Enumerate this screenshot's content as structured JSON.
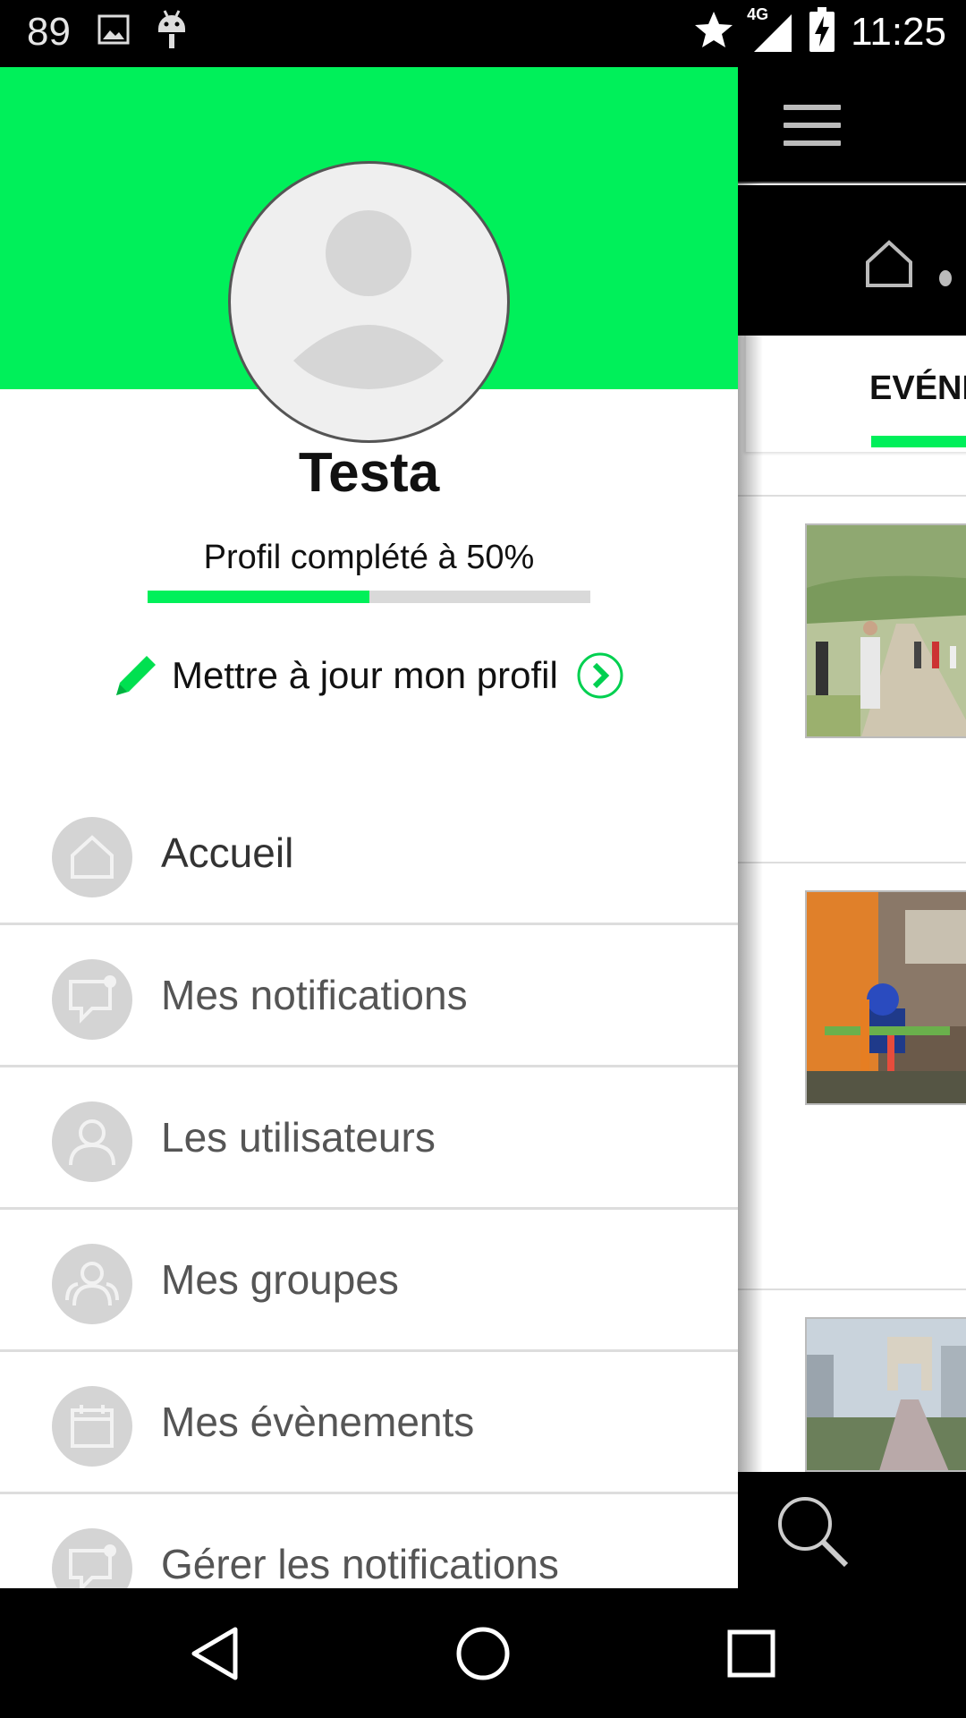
{
  "status_bar": {
    "notification_count": "89",
    "network_label": "4G",
    "time": "11:25",
    "icons": [
      "image-icon",
      "android-icon",
      "star-icon",
      "signal-icon",
      "battery-charging-icon"
    ]
  },
  "background_app": {
    "tab_label": "EVÉNE",
    "icons": [
      "hamburger-icon",
      "home-icon",
      "search-icon"
    ]
  },
  "drawer": {
    "user_name": "Testa",
    "profile_progress_text": "Profil complété à 50%",
    "profile_progress_fraction": 0.5,
    "update_profile_label": "Mettre à jour mon profil",
    "menu_items": [
      {
        "label": "Accueil",
        "icon": "home-icon"
      },
      {
        "label": "Mes notifications",
        "icon": "notification-bubble-icon"
      },
      {
        "label": "Les utilisateurs",
        "icon": "user-icon"
      },
      {
        "label": "Mes groupes",
        "icon": "group-icon"
      },
      {
        "label": "Mes évènements",
        "icon": "calendar-icon"
      },
      {
        "label": "Gérer les notifications",
        "icon": "notification-bubble-icon"
      }
    ]
  },
  "colors": {
    "accent_green": "#00f05a",
    "menu_icon_bg": "#d4d4d4",
    "progress_track": "#d9d9d9"
  },
  "nav_bar": {
    "buttons": [
      "back-icon",
      "home-circle-icon",
      "recents-icon"
    ]
  }
}
